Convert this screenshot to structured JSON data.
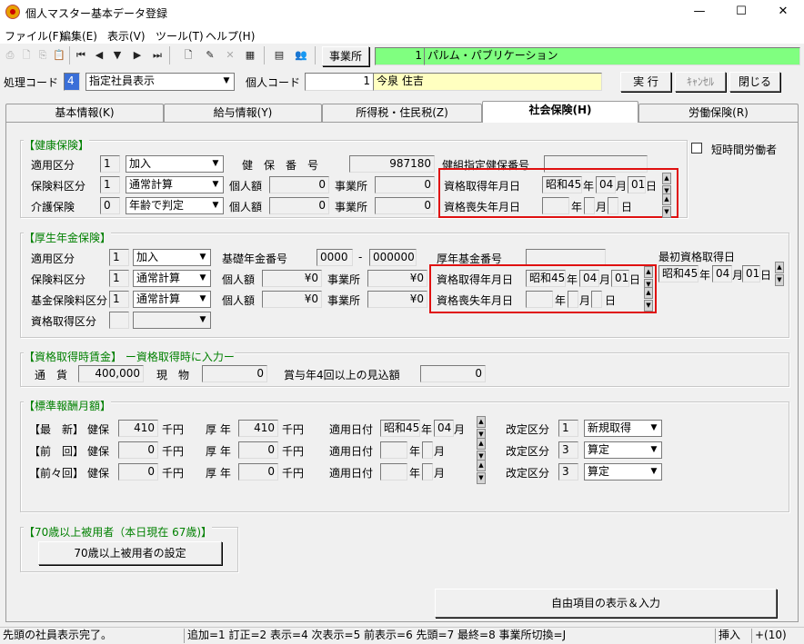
{
  "window": {
    "title": "個人マスター基本データ登録",
    "minimize": "—",
    "maximize": "☐",
    "close": "✕"
  },
  "menu": [
    "ファイル(F)",
    "編集(E)",
    "表示(V)",
    "ツール(T)",
    "ヘルプ(H)"
  ],
  "toolbar": {
    "office_label": "事業所",
    "office_no": "1",
    "office_name": "パルム・パブリケーション"
  },
  "process": {
    "label": "処理コード",
    "code": "4",
    "mode": "指定社員表示",
    "person_label": "個人コード",
    "person_code": "1",
    "person_name": "今泉 住吉",
    "execute": "実 行",
    "cancel": "ｷｬﾝｾﾙ",
    "close": "閉じる"
  },
  "tabs": [
    "基本情報(K)",
    "給与情報(Y)",
    "所得税・住民税(Z)",
    "社会保険(H)",
    "労働保険(R)"
  ],
  "kenko": {
    "title": "【健康保険】",
    "tekiyo_label": "適用区分",
    "tekiyo_no": "1",
    "tekiyo_val": "加入",
    "bango_label": "健　保　番　号",
    "bango_val": "987180",
    "shitei_label": "健組指定健保番号",
    "shitei_val": "",
    "hoken_label": "保険料区分",
    "hoken_no": "1",
    "hoken_val": "通常計算",
    "kojin_label": "個人額",
    "kojin_val": "0",
    "jigyo_label": "事業所",
    "jigyo_val": "0",
    "kaigo_label": "介護保険",
    "kaigo_no": "0",
    "kaigo_val": "年齢で判定",
    "kojin2_val": "0",
    "jigyo2_val": "0",
    "shutoku_label": "資格取得年月日",
    "shutoku_era": "昭和45",
    "shutoku_y": "年",
    "shutoku_m": "04",
    "m_lbl": "月",
    "shutoku_d": "01",
    "d_lbl": "日",
    "soshitsu_label": "資格喪失年月日",
    "soshitsu_y": "年",
    "soshitsu_m": "月",
    "soshitsu_d": "日"
  },
  "short_time": "短時間労働者",
  "kosei": {
    "title": "【厚生年金保険】",
    "tekiyo_label": "適用区分",
    "tekiyo_no": "1",
    "tekiyo_val": "加入",
    "kiso_label": "基礎年金番号",
    "kiso_1": "0000",
    "dash": "-",
    "kiso_2": "000000",
    "kikin_label": "厚年基金番号",
    "hoken_label": "保険料区分",
    "hoken_no": "1",
    "hoken_val": "通常計算",
    "kojin_label": "個人額",
    "kojin_val": "¥0",
    "jigyo_label": "事業所",
    "jigyo_val": "¥0",
    "kikin_hoken_label": "基金保険料区分",
    "kikin_hoken_no": "1",
    "kikin_hoken_val": "通常計算",
    "kojin2_val": "¥0",
    "jigyo2_val": "¥0",
    "shikaku_kubun_label": "資格取得区分",
    "shutoku_label": "資格取得年月日",
    "shutoku_era": "昭和45",
    "y": "年",
    "shutoku_m": "04",
    "m": "月",
    "shutoku_d": "01",
    "d": "日",
    "soshitsu_label": "資格喪失年月日",
    "saisho_label": "最初資格取得日",
    "saisho_era": "昭和45",
    "saisho_m": "04",
    "saisho_d": "01"
  },
  "chingin": {
    "title": "【資格取得時賃金】 ー資格取得時に入力ー",
    "tsuka_label": "通　貨",
    "tsuka_val": "400,000",
    "genbutsu_label": "現　物",
    "genbutsu_val": "0",
    "shoyo_label": "賞与年4回以上の見込額",
    "shoyo_val": "0"
  },
  "hyojun": {
    "title": "【標準報酬月額】",
    "rows": [
      {
        "label": "【最　新】",
        "kenpo_val": "410",
        "kosei_val": "410",
        "date_era": "昭和45",
        "date_y": "年",
        "date_m": "04",
        "date_ml": "月",
        "kaitei_no": "1",
        "kaitei_val": "新規取得"
      },
      {
        "label": "【前　回】",
        "kenpo_val": "0",
        "kosei_val": "0",
        "date_era": "",
        "date_y": "年",
        "date_m": "",
        "date_ml": "月",
        "kaitei_no": "3",
        "kaitei_val": "算定"
      },
      {
        "label": "【前々回】",
        "kenpo_val": "0",
        "kosei_val": "0",
        "date_era": "",
        "date_y": "年",
        "date_m": "",
        "date_ml": "月",
        "kaitei_no": "3",
        "kaitei_val": "算定"
      }
    ],
    "kenpo": "健保",
    "kosei": "厚 年",
    "unit": "千円",
    "tekiyo": "適用日付",
    "kaitei": "改定区分"
  },
  "over70": {
    "title": "【70歳以上被用者（本日現在 67歳)】",
    "button": "70歳以上被用者の設定"
  },
  "free_button": "自由項目の表示＆入力",
  "status": {
    "message": "先頭の社員表示完了。",
    "keys": "追加=1 訂正=2 表示=4 次表示=5 前表示=6 先頭=7 最終=8 事業所切換=J",
    "mode": "挿入",
    "count": "+(10)"
  }
}
